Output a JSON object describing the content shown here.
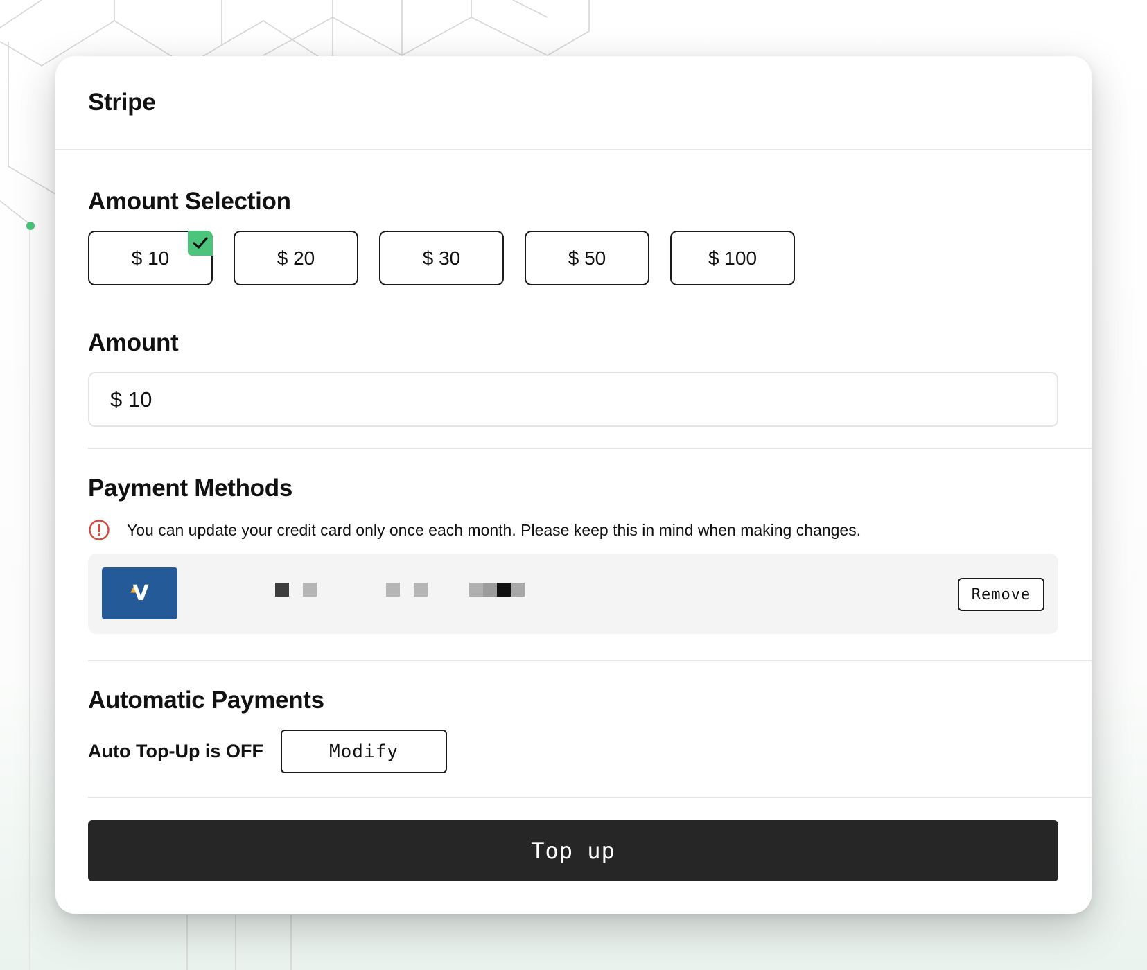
{
  "header": {
    "title": "Stripe"
  },
  "amount_selection": {
    "title": "Amount Selection",
    "options": [
      "$ 10",
      "$ 20",
      "$ 30",
      "$ 50",
      "$ 100"
    ],
    "selected": "$ 10"
  },
  "amount": {
    "title": "Amount",
    "value": "$ 10"
  },
  "payment_methods": {
    "title": "Payment Methods",
    "notice": "You can update your credit card only once each month. Please keep this in mind when making changes.",
    "card_logo_letter": "V",
    "remove_label": "Remove"
  },
  "automatic_payments": {
    "title": "Automatic Payments",
    "status": "Auto Top-Up is OFF",
    "modify_label": "Modify"
  },
  "topup_label": "Top up",
  "colors": {
    "accent_check": "#4dc47b",
    "warning": "#d9463a",
    "card_brand": "#255a99",
    "primary_button": "#262626"
  },
  "icons": {
    "check": "check-icon",
    "warning": "exclamation-circle-icon",
    "card": "visa-card-icon"
  }
}
